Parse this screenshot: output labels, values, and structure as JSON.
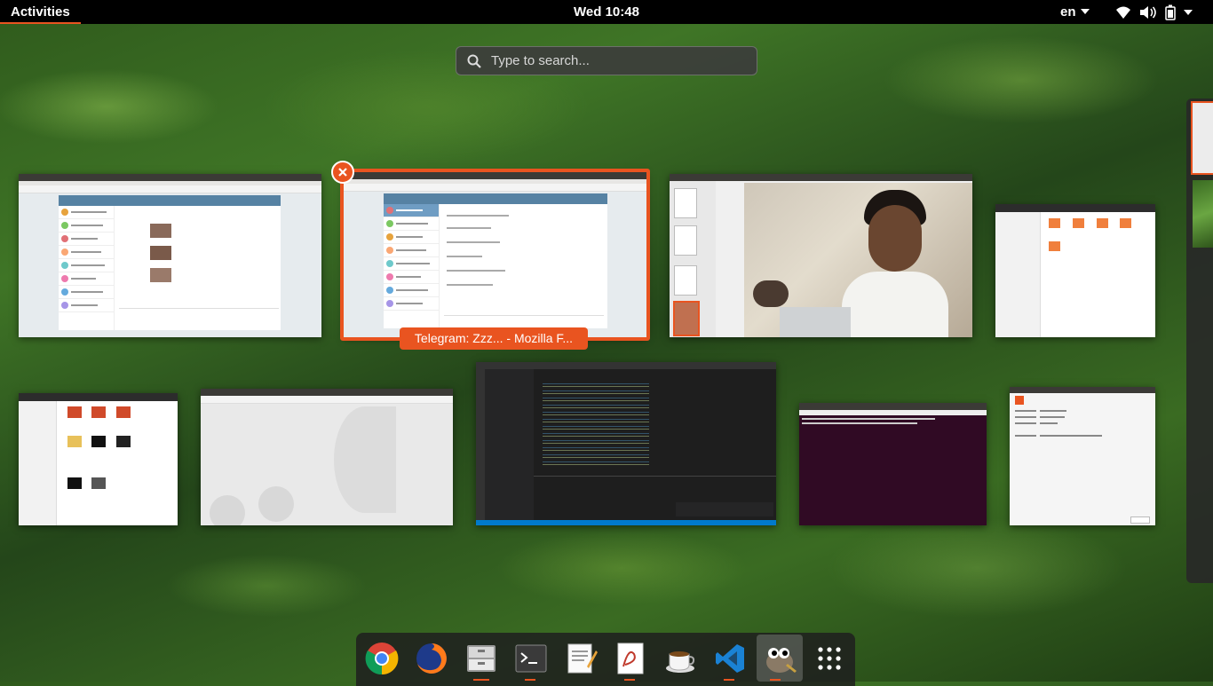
{
  "topbar": {
    "activities_label": "Activities",
    "clock": "Wed 10:48",
    "language": "en"
  },
  "search": {
    "placeholder": "Type to search..."
  },
  "windows": {
    "selected_caption": "Telegram: Zzz... - Mozilla F..."
  },
  "dock": {
    "apps": [
      "chrome-icon",
      "firefox-icon",
      "files-icon",
      "terminal-icon",
      "text-editor-icon",
      "pdf-viewer-icon",
      "java-icon",
      "vscode-icon",
      "gimp-icon",
      "show-apps-icon"
    ]
  },
  "colors": {
    "accent": "#e95420",
    "topbar": "#000000"
  }
}
